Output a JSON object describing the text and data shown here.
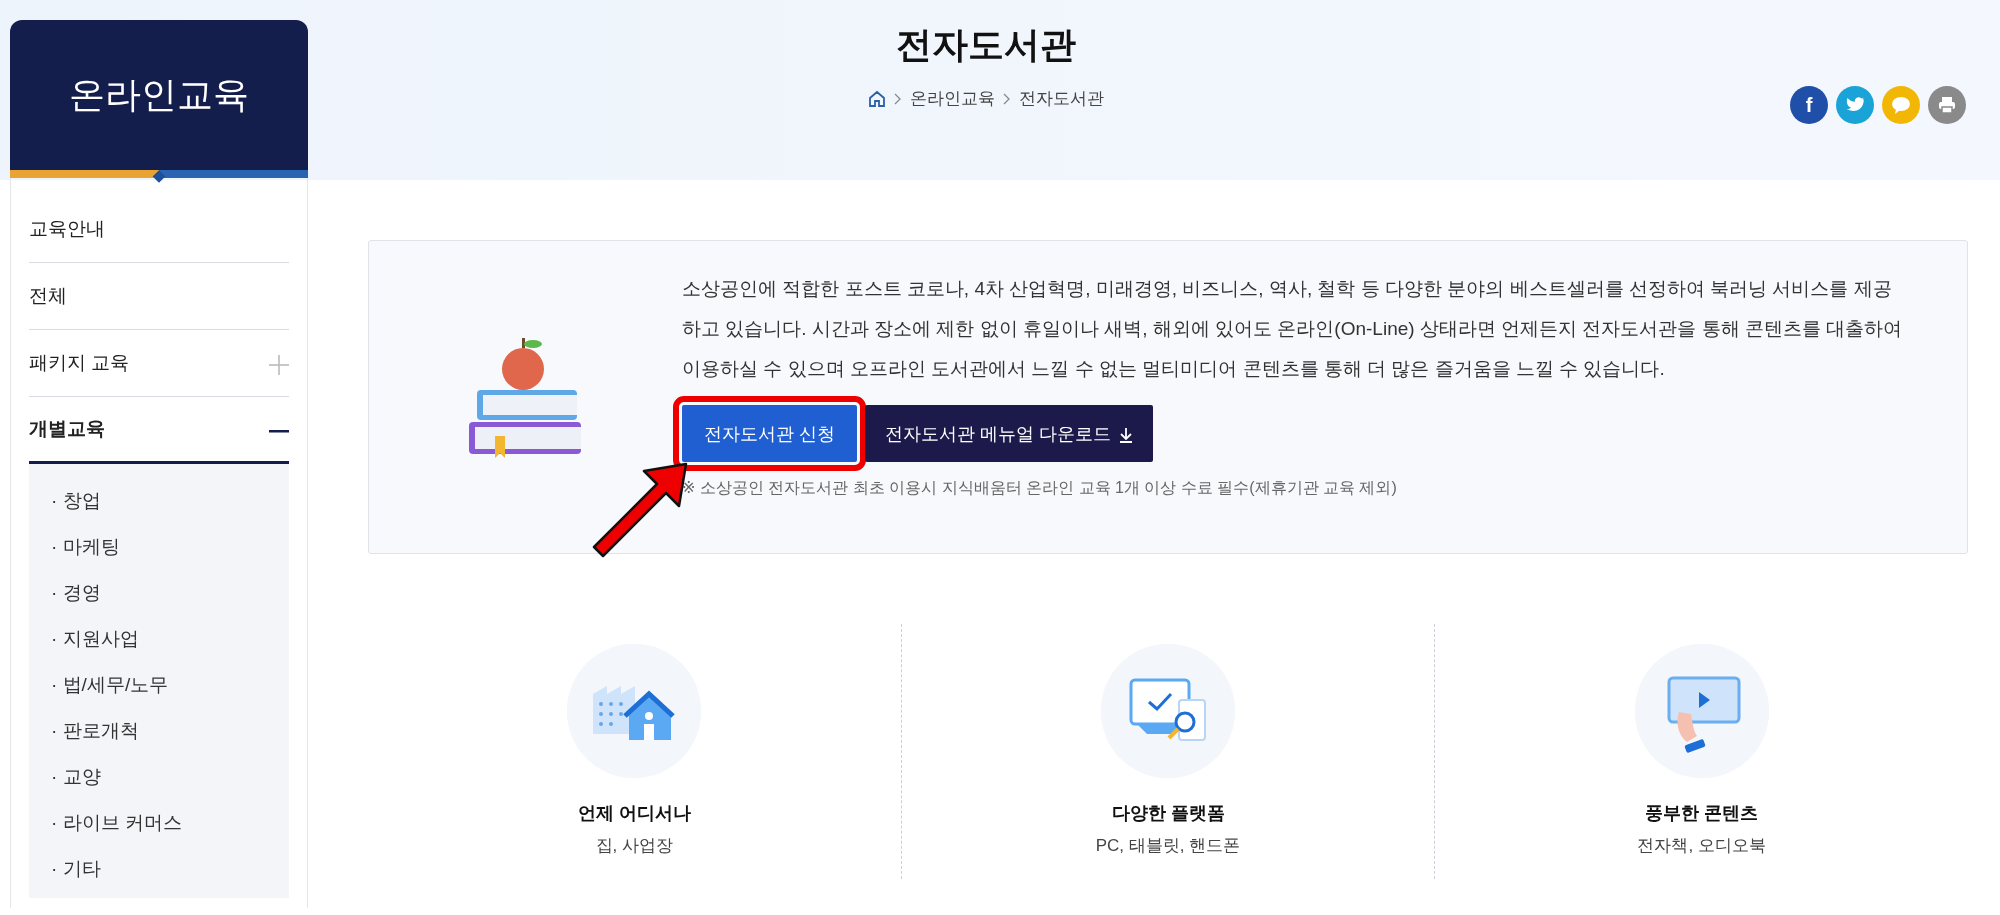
{
  "sidebar": {
    "title": "온라인교육",
    "items": [
      {
        "label": "교육안내",
        "kind": "link"
      },
      {
        "label": "전체",
        "kind": "link"
      },
      {
        "label": "패키지 교육",
        "kind": "group",
        "expanded": false
      },
      {
        "label": "개별교육",
        "kind": "group",
        "expanded": true,
        "children": [
          {
            "label": "· 창업"
          },
          {
            "label": "· 마케팅"
          },
          {
            "label": "· 경영"
          },
          {
            "label": "· 지원사업"
          },
          {
            "label": "· 법/세무/노무"
          },
          {
            "label": "· 판로개척"
          },
          {
            "label": "· 교양"
          },
          {
            "label": "· 라이브 커머스"
          },
          {
            "label": "· 기타"
          }
        ]
      }
    ]
  },
  "header": {
    "title": "전자도서관",
    "breadcrumb": [
      "온라인교육",
      "전자도서관"
    ],
    "share_buttons": [
      {
        "kind": "facebook",
        "label": "f",
        "color": "#1f4fa8"
      },
      {
        "kind": "twitter",
        "color": "#1aa3d6"
      },
      {
        "kind": "kakao",
        "color": "#f2b705"
      },
      {
        "kind": "print",
        "color": "#8a8a8a"
      }
    ]
  },
  "intro": {
    "text": "소상공인에 적합한 포스트 코로나, 4차 산업혁명, 미래경영, 비즈니스, 역사, 철학 등 다양한 분야의 베스트셀러를 선정하여 북러닝 서비스를 제공하고 있습니다. 시간과 장소에 제한 없이 휴일이나 새벽, 해외에 있어도 온라인(On-Line) 상태라면 언제든지 전자도서관을 통해 콘텐츠를 대출하여 이용하실 수 있으며 오프라인 도서관에서 느낄 수 없는 멀티미디어 콘텐츠를 통해 더 많은 즐거움을 느낄 수 있습니다.",
    "buttons": [
      {
        "label": "전자도서관 신청",
        "kind": "primary",
        "highlighted": true
      },
      {
        "label": "전자도서관 메뉴얼 다운로드",
        "kind": "download",
        "highlighted": false
      }
    ],
    "note": "※ 소상공인 전자도서관 최초 이용시 지식배움터 온라인 교육 1개 이상 수료 필수(제휴기관 교육 제외)"
  },
  "features": [
    {
      "kind": "place",
      "title": "언제 어디서나",
      "subtitle": "집, 사업장"
    },
    {
      "kind": "platform",
      "title": "다양한 플랫폼",
      "subtitle": "PC, 태블릿, 핸드폰"
    },
    {
      "kind": "content",
      "title": "풍부한 콘텐츠",
      "subtitle": "전자책, 오디오북"
    }
  ]
}
